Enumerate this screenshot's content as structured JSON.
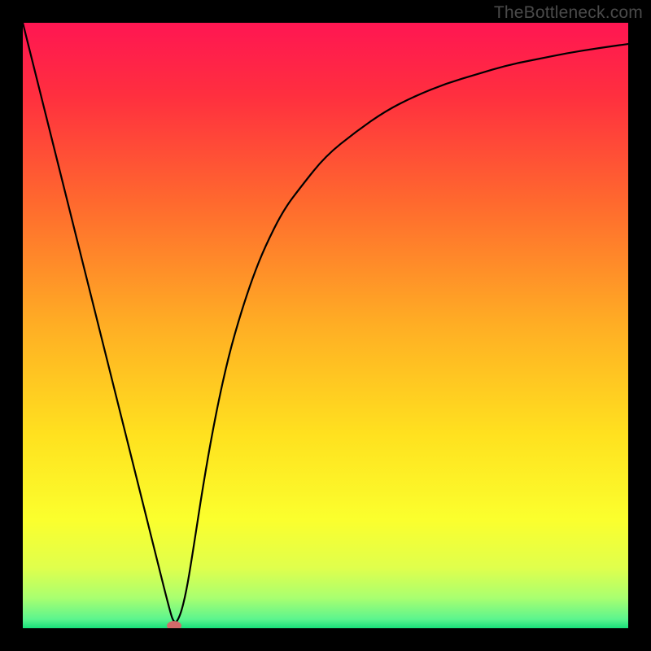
{
  "watermark": "TheBottleneck.com",
  "chart_data": {
    "type": "line",
    "title": "",
    "xlabel": "",
    "ylabel": "",
    "xlim": [
      0,
      100
    ],
    "ylim": [
      0,
      100
    ],
    "background_gradient": {
      "stops": [
        {
          "offset": 0.0,
          "color": "#ff1652"
        },
        {
          "offset": 0.12,
          "color": "#ff2f3f"
        },
        {
          "offset": 0.3,
          "color": "#ff6a2e"
        },
        {
          "offset": 0.5,
          "color": "#ffae24"
        },
        {
          "offset": 0.68,
          "color": "#ffe11f"
        },
        {
          "offset": 0.82,
          "color": "#fbff2d"
        },
        {
          "offset": 0.9,
          "color": "#e0ff4c"
        },
        {
          "offset": 0.95,
          "color": "#a9ff70"
        },
        {
          "offset": 0.985,
          "color": "#5cf58e"
        },
        {
          "offset": 1.0,
          "color": "#18e07a"
        }
      ]
    },
    "series": [
      {
        "name": "curve",
        "color": "#000000",
        "width": 2.2,
        "x": [
          0,
          2,
          4,
          6,
          8,
          10,
          12,
          14,
          16,
          18,
          20,
          22,
          24,
          25,
          26,
          27,
          28,
          30,
          32,
          34,
          36,
          38,
          40,
          43,
          46,
          50,
          55,
          60,
          65,
          70,
          75,
          80,
          85,
          90,
          95,
          100
        ],
        "y": [
          100,
          92,
          84,
          76,
          68,
          60,
          52,
          44,
          36,
          28,
          20,
          12,
          4,
          0.5,
          2,
          6,
          12,
          25,
          36,
          45,
          52,
          58,
          63,
          69,
          73,
          78,
          82,
          85.5,
          88,
          90,
          91.5,
          93,
          94,
          95,
          95.8,
          96.5
        ]
      }
    ],
    "marker": {
      "x": 25,
      "y": 0.4,
      "rx": 1.2,
      "ry": 0.8,
      "color": "#d26a6a"
    }
  }
}
